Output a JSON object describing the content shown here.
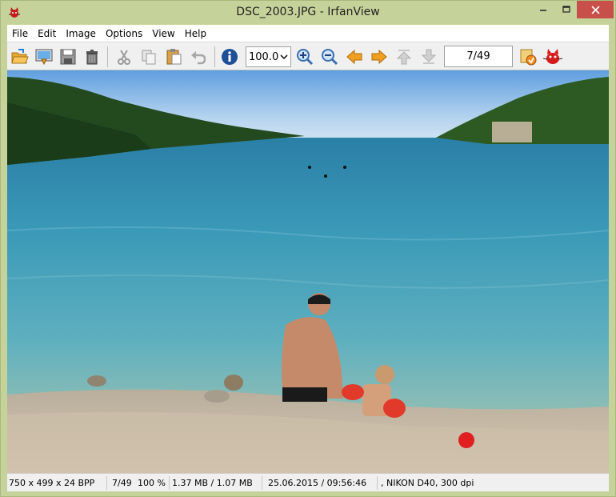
{
  "window": {
    "title": "DSC_2003.JPG - IrfanView"
  },
  "menu": {
    "items": [
      {
        "label": "File",
        "name": "menu-file"
      },
      {
        "label": "Edit",
        "name": "menu-edit"
      },
      {
        "label": "Image",
        "name": "menu-image"
      },
      {
        "label": "Options",
        "name": "menu-options"
      },
      {
        "label": "View",
        "name": "menu-view"
      },
      {
        "label": "Help",
        "name": "menu-help"
      }
    ]
  },
  "toolbar": {
    "zoom_value": "100.0",
    "page_indicator": "7/49",
    "icons": [
      "open-folder-icon",
      "slideshow-icon",
      "save-icon",
      "delete-trash-icon",
      "cut-icon",
      "copy-icon",
      "paste-icon",
      "undo-icon",
      "info-icon",
      "zoom-in-icon",
      "zoom-out-icon",
      "previous-arrow-icon",
      "next-arrow-icon",
      "first-file-icon",
      "last-file-icon",
      "thumbnails-icon",
      "irfanview-cat-icon"
    ]
  },
  "statusbar": {
    "dimensions": "750 x 499 x 24 BPP",
    "index": "7/49",
    "zoom": "100 %",
    "size": "1.37 MB / 1.07 MB",
    "datetime": "25.06.2015 / 09:56:46",
    "camera": ", NIKON D40, 300 dpi"
  },
  "colors": {
    "window_frame": "#c5d39a",
    "close_button": "#c7504a",
    "toolbar_bg": "#f0f0f0"
  },
  "image": {
    "description_icon": "photo-viewport"
  }
}
